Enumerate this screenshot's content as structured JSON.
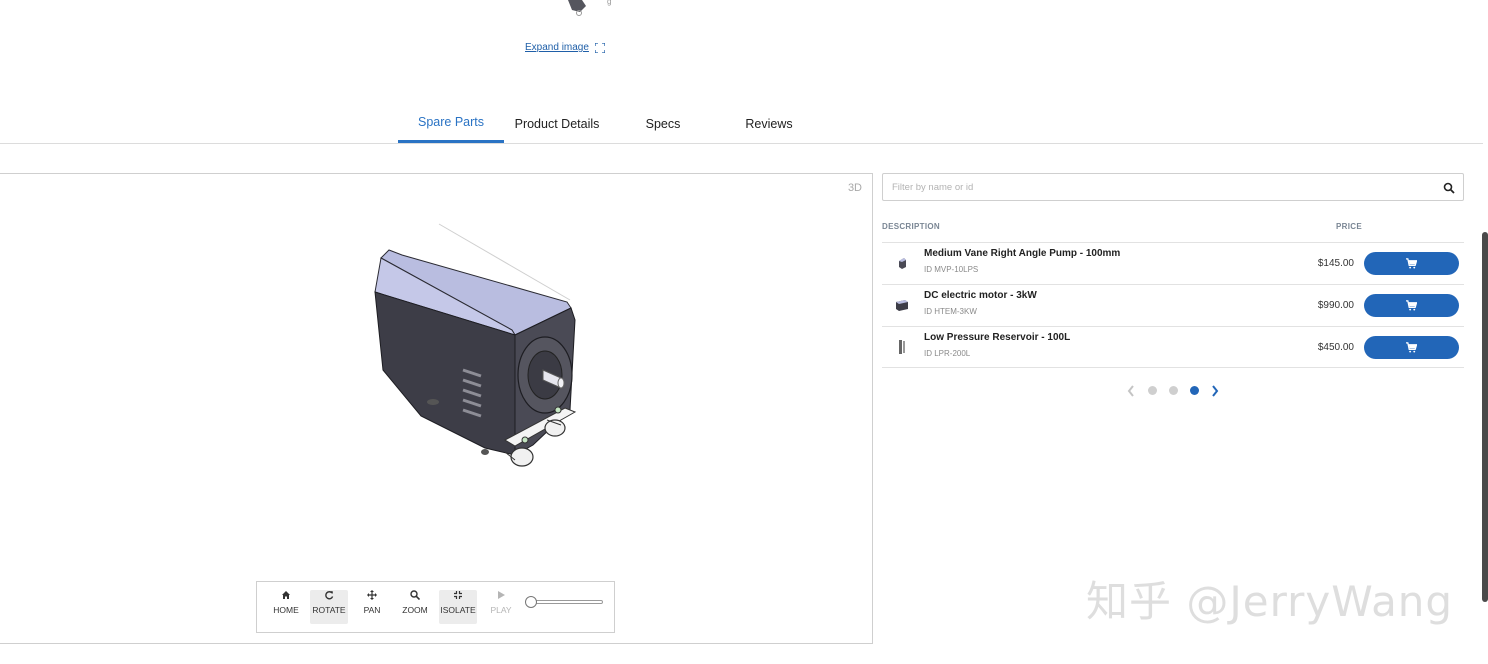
{
  "expand_image": {
    "label": "Expand image",
    "icon": "expand-icon"
  },
  "tabs": [
    {
      "label": "Spare Parts",
      "active": true
    },
    {
      "label": "Product Details",
      "active": false
    },
    {
      "label": "Specs",
      "active": false
    },
    {
      "label": "Reviews",
      "active": false
    }
  ],
  "viewer": {
    "mode_label": "3D",
    "toolbar": [
      {
        "label": "HOME",
        "icon": "home-icon"
      },
      {
        "label": "ROTATE",
        "icon": "rotate-icon",
        "active": true
      },
      {
        "label": "PAN",
        "icon": "pan-icon"
      },
      {
        "label": "ZOOM",
        "icon": "zoom-icon"
      },
      {
        "label": "ISOLATE",
        "icon": "isolate-icon",
        "active": true
      },
      {
        "label": "PLAY",
        "icon": "play-icon",
        "disabled": true
      }
    ],
    "animation_progress": 0
  },
  "parts": {
    "filter_placeholder": "Filter by name or id",
    "headers": {
      "description": "DESCRIPTION",
      "price": "PRICE"
    },
    "rows": [
      {
        "name": "Medium Vane Right Angle Pump - 100mm",
        "id": "ID MVP-10LPS",
        "price": "$145.00"
      },
      {
        "name": "DC electric motor - 3kW",
        "id": "ID HTEM-3KW",
        "price": "$990.00"
      },
      {
        "name": "Low Pressure Reservoir - 100L",
        "id": "ID LPR-200L",
        "price": "$450.00"
      }
    ],
    "pagination": {
      "pages": 3,
      "current": 3
    }
  },
  "watermark": "知乎 @JerryWang",
  "colors": {
    "accent": "#2266b8",
    "tab_active": "#2a73c4",
    "motor_top": "#b9bde0",
    "motor_body": "#3a3a44"
  }
}
